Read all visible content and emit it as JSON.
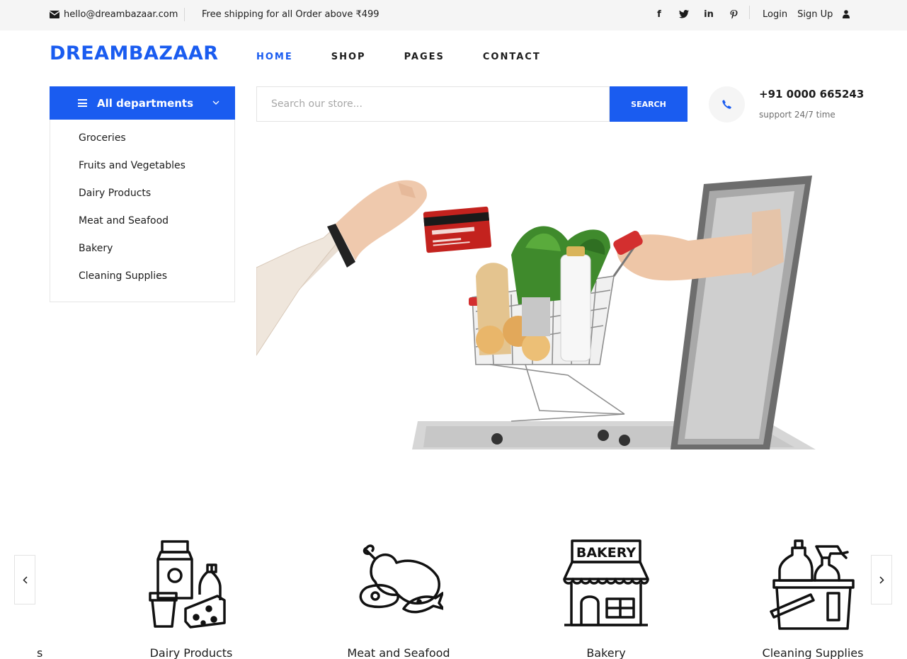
{
  "topbar": {
    "email": "hello@dreambazaar.com",
    "shipping": "Free shipping for all Order above ₹499",
    "socials": [
      "facebook-icon",
      "twitter-icon",
      "linkedin-icon",
      "pinterest-icon"
    ],
    "login": "Login",
    "signup": "Sign Up"
  },
  "brand": {
    "logo": "DREAMBAZAAR",
    "accent": "#1a5cf0"
  },
  "nav": {
    "home": "HOME",
    "shop": "SHOP",
    "pages": "PAGES",
    "contact": "CONTACT"
  },
  "departments": {
    "title": "All departments",
    "items": [
      "Groceries",
      "Fruits and Vegetables",
      "Dairy Products",
      "Meat and Seafood",
      "Bakery",
      "Cleaning Supplies"
    ]
  },
  "search": {
    "placeholder": "Search our store...",
    "button": "SEARCH"
  },
  "contact": {
    "phone": "+91 0000 665243",
    "support": "support 24/7 time"
  },
  "categories": {
    "edge_fragment": "s",
    "items": [
      "Dairy Products",
      "Meat and Seafood",
      "Bakery",
      "Cleaning Supplies"
    ],
    "bakery_sign": "BAKERY"
  }
}
